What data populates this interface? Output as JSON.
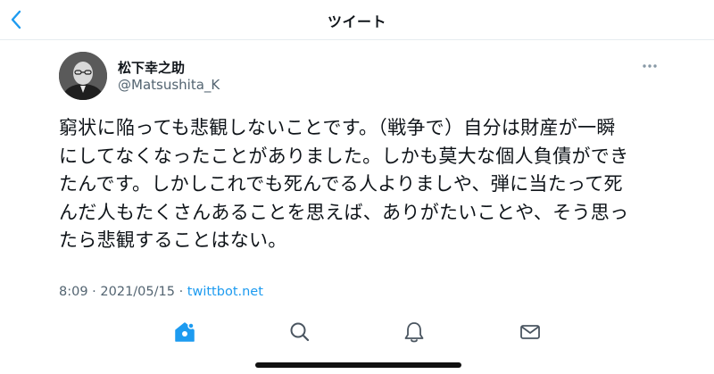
{
  "header": {
    "title": "ツイート",
    "back_icon": "chevron-left-icon"
  },
  "tweet": {
    "author_name": "松下幸之助",
    "author_handle": "@Matsushita_K",
    "text_lines": [
      "窮状に陥っても悲観しないことです。（戦争で）自分は財産が一瞬",
      "にしてなくなったことがありました。しかも莫大な個人負債ができ",
      "たんです。しかしこれでも死んでる人よりましや、弾に当たって死",
      "んだ人もたくさんあることを思えば、ありがたいことや、そう思っ",
      "たら悲観することはない。"
    ],
    "time": "8:09",
    "date": "2021/05/15",
    "source": "twittbot.net"
  },
  "tabbar": {
    "items": [
      "home-icon",
      "search-icon",
      "notifications-icon",
      "messages-icon"
    ],
    "active": "home-icon"
  },
  "colors": {
    "accent": "#1d9bf0",
    "text": "#0f1419",
    "muted": "#536471"
  }
}
